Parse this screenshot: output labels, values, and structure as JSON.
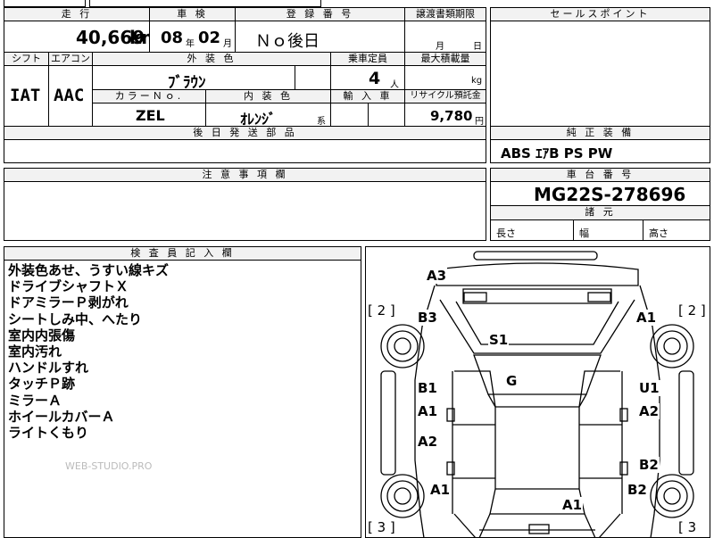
{
  "top_left": {
    "mileage_header": "走 行",
    "mileage_value": "40,669",
    "mileage_unit": "km",
    "inspection_header": "車 検",
    "inspection_year": "08",
    "inspection_year_unit": "年",
    "inspection_month": "02",
    "inspection_month_unit": "月",
    "registration_header": "登 録 番 号",
    "registration_value": "Ｎｏ後日",
    "transfer_header": "譲渡書類期限",
    "transfer_month_unit": "月",
    "transfer_day_unit": "日",
    "shift_header": "シフト",
    "shift_value": "IAT",
    "ac_header": "エアコン",
    "ac_value": "AAC",
    "exterior_header": "外 装 色",
    "exterior_value": "ﾌﾞﾗｳﾝ",
    "capacity_header": "乗車定員",
    "capacity_value": "4",
    "capacity_unit": "人",
    "load_header": "最大積載量",
    "load_unit": "kg",
    "color_no_header": "カラーＮｏ.",
    "color_no_value": "ZEL",
    "interior_header": "内 装 色",
    "interior_value": "ｵﾚﾝｼﾞ",
    "interior_suffix": "系",
    "import_header": "輸 入 車",
    "recycle_header": "リサイクル預託金",
    "recycle_value": "9,780",
    "recycle_unit": "円",
    "later_parts_header": "後 日 発 送 部 品"
  },
  "sales_point": {
    "header": "セールスポイント"
  },
  "equipment": {
    "header": "純 正 装 備",
    "value": "ABS ｴｱB PS PW"
  },
  "caution": {
    "header": "注 意 事 項 欄"
  },
  "chassis": {
    "header": "車 台 番 号",
    "value": "MG22S-278696",
    "dims_header": "諸 元",
    "length_label": "長さ",
    "width_label": "幅",
    "height_label": "高さ"
  },
  "inspector": {
    "header": "検 査 員 記 入 欄",
    "notes": [
      "外装色あせ、うすい線キズ",
      "ドライブシャフトＸ",
      "ドアミラーＰ剥がれ",
      "シートしみ中、へたり",
      "室内内張傷",
      "室内汚れ",
      "ハンドルすれ",
      "タッチＰ跡",
      "ミラーＡ",
      "ホイールカバーＡ",
      "ライトくもり"
    ],
    "watermark": "WEB-STUDIO.PRO"
  },
  "diagram": {
    "marks": {
      "a3": "A3",
      "b3": "B3",
      "a1_fr": "A1",
      "s1": "S1",
      "g": "G",
      "b1_l": "B1",
      "a1_l1": "A1",
      "u1": "U1",
      "a2_r": "A2",
      "a2_l": "A2",
      "b2_r1": "B2",
      "a1_l2": "A1",
      "b2_r2": "B2",
      "a1_rear": "A1"
    },
    "brackets": {
      "tl": "[ 2 ]",
      "tr": "[ 2 ]",
      "bl": "[ 3 ]",
      "br": "[ 3"
    }
  }
}
